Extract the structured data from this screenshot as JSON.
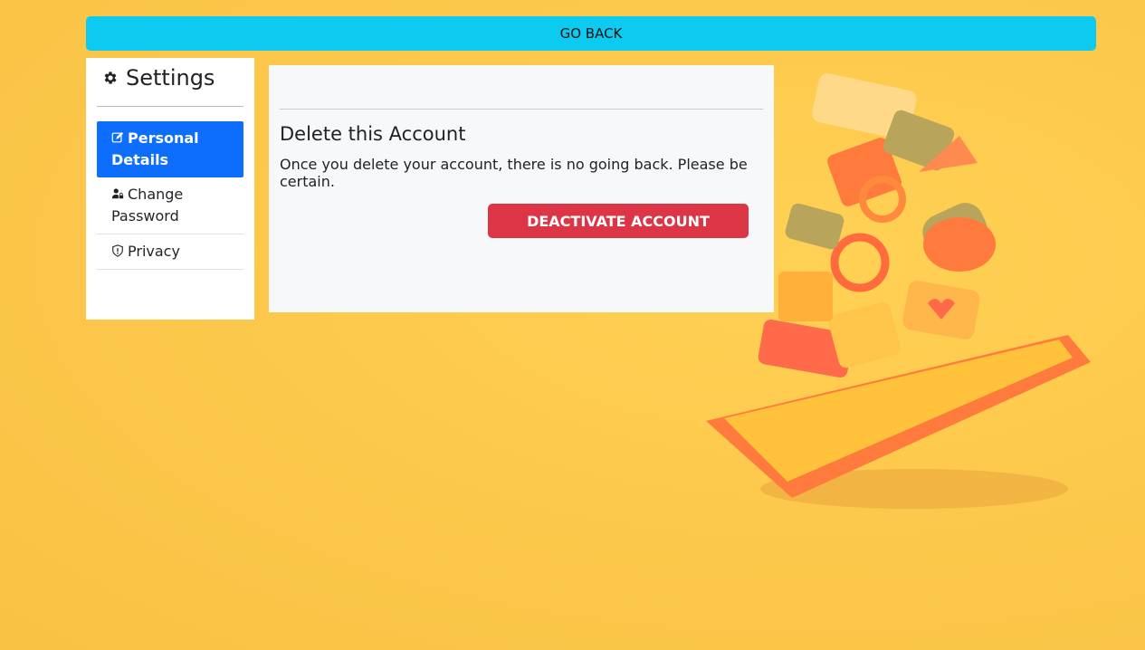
{
  "header": {
    "go_back_label": "GO BACK"
  },
  "sidebar": {
    "title": "Settings",
    "items": [
      {
        "label": "Personal Details",
        "icon": "edit-icon",
        "active": true
      },
      {
        "label": "Change Password",
        "icon": "user-lock-icon",
        "active": false
      },
      {
        "label": "Privacy",
        "icon": "shield-icon",
        "active": false
      }
    ]
  },
  "main": {
    "section_title": "Delete this Account",
    "section_text": "Once you delete your account, there is no going back. Please be certain.",
    "deactivate_label": "DEACTIVATE ACCOUNT"
  },
  "colors": {
    "background": "#fdc94c",
    "go_back": "#0dcaf0",
    "active_nav": "#0d6efd",
    "danger": "#dc3545"
  }
}
